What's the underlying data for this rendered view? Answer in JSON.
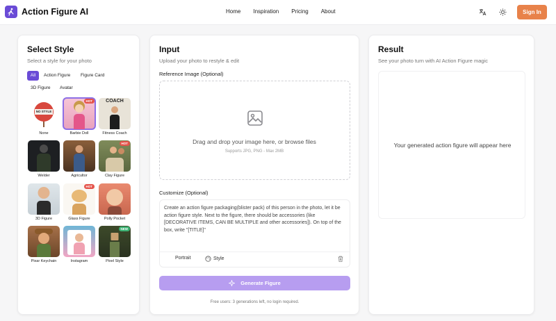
{
  "header": {
    "brand": "Action Figure AI",
    "logo_icon": "running-figure-icon",
    "nav": [
      "Home",
      "Inspiration",
      "Pricing",
      "About"
    ],
    "signin": "Sign In",
    "accent": "#e8824a"
  },
  "style_panel": {
    "title": "Select Style",
    "subtitle": "Select a style for your photo",
    "tabs": [
      "All",
      "Action Figure",
      "Figure Card",
      "3D Figure",
      "Avatar"
    ],
    "active_tab": "All",
    "styles": [
      {
        "name": "None",
        "badge": ""
      },
      {
        "name": "Barbie Doll",
        "badge": "HOT"
      },
      {
        "name": "Fitness Coach",
        "badge": "",
        "thumb_text": "COACH"
      },
      {
        "name": "Welder",
        "badge": ""
      },
      {
        "name": "Agricultor",
        "badge": ""
      },
      {
        "name": "Clay Figure",
        "badge": "HOT"
      },
      {
        "name": "3D Figure",
        "badge": ""
      },
      {
        "name": "Glass Figure",
        "badge": "HOT"
      },
      {
        "name": "Polly Pocket",
        "badge": ""
      },
      {
        "name": "Pixar Keychain",
        "badge": ""
      },
      {
        "name": "Instagram",
        "badge": ""
      },
      {
        "name": "Pixel Style",
        "badge": "NEW"
      }
    ],
    "none_sign_text": "NO STYLE"
  },
  "input_panel": {
    "title": "Input",
    "subtitle": "Upload your photo to restyle & edit",
    "ref_label": "Reference Image (Optional)",
    "drop_text": "Drag and drop your image here, or browse files",
    "drop_hint": "Supports JPG, PNG - Max 2MB",
    "customize_label": "Customize (Optional)",
    "prompt": "Create an action figure packaging(blister pack) of this person in the photo, let it be action figure style. Next to the figure, there should be accessories (like [DECORATIVE ITEMS, CAN BE MULTIPLE and other accessories]). On top of the box, write \"[TITLE]\"",
    "portrait_label": "Portrait",
    "style_label": "Style",
    "generate_label": "Generate Figure",
    "footer_note": "Free users: 3 generations left, no login required."
  },
  "result_panel": {
    "title": "Result",
    "subtitle": "See your photo turn with AI Action Figure magic",
    "placeholder": "Your generated action figure will appear here"
  }
}
